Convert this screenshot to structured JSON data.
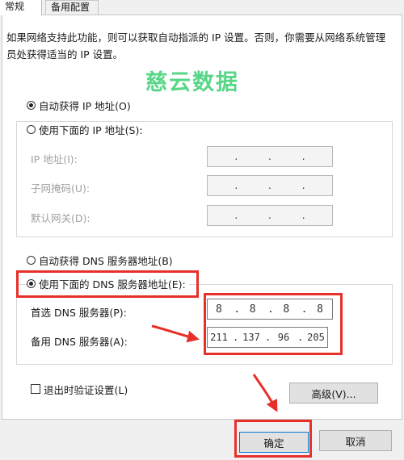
{
  "tabs": {
    "general": "常规",
    "alternate": "备用配置"
  },
  "description": "如果网络支持此功能，则可以获取自动指派的 IP 设置。否则，你需要从网络系统管理员处获得适当的 IP 设置。",
  "watermark": "慈云数据",
  "ip_section": {
    "auto_ip": "自动获得 IP 地址(O)",
    "manual_ip": "使用下面的 IP 地址(S):",
    "ip_address_label": "IP 地址(I):",
    "subnet_label": "子网掩码(U):",
    "gateway_label": "默认网关(D):",
    "empty_dots": "."
  },
  "dns_section": {
    "auto_dns": "自动获得 DNS 服务器地址(B)",
    "manual_dns": "使用下面的 DNS 服务器地址(E):",
    "preferred_label": "首选 DNS 服务器(P):",
    "alternate_label": "备用 DNS 服务器(A):",
    "preferred": {
      "s1": "8",
      "s2": "8",
      "s3": "8",
      "s4": "8"
    },
    "alternate": {
      "s1": "211",
      "s2": "137",
      "s3": "96",
      "s4": "205"
    },
    "dot": "."
  },
  "validate_checkbox": "退出时验证设置(L)",
  "advanced_button": "高级(V)...",
  "ok_button": "确定",
  "cancel_button": "取消",
  "colors": {
    "annotation_red": "#e8302a",
    "watermark_green": "#3ccf73"
  }
}
